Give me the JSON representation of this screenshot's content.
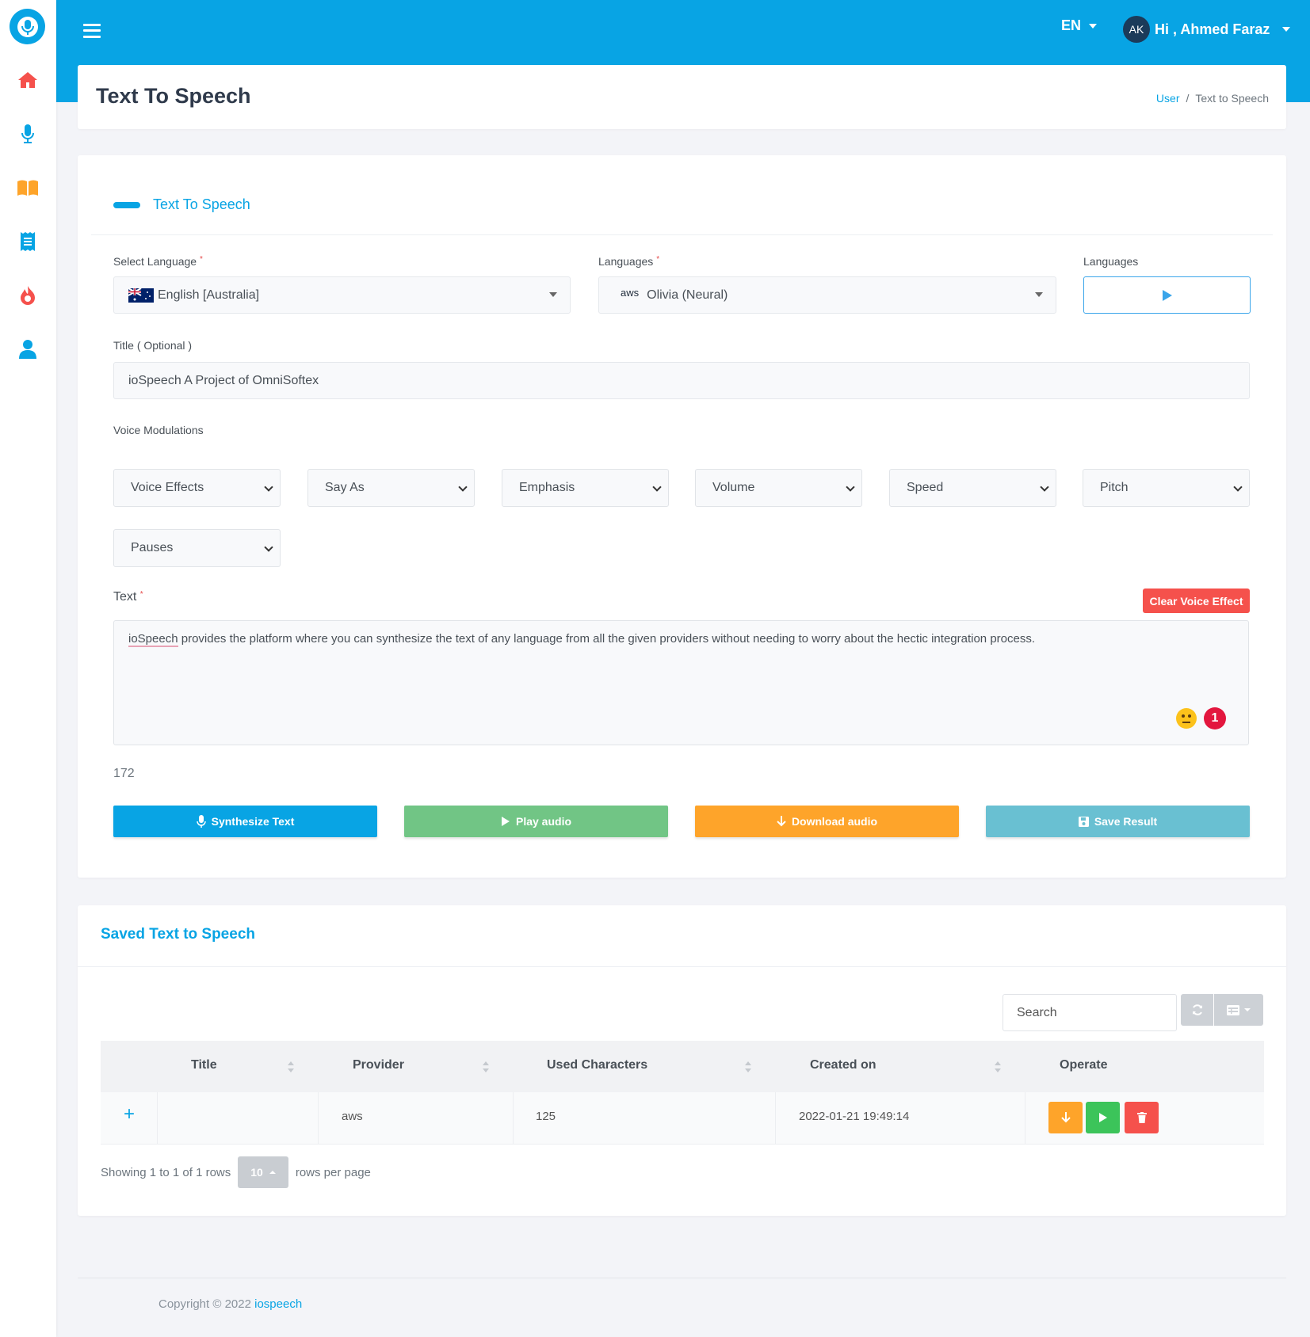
{
  "header": {
    "language": "EN",
    "user_initials": "AK",
    "user_greeting": "Hi , Ahmed Faraz"
  },
  "sidebar": {
    "items": [
      "home-icon",
      "microphone-icon",
      "book-icon",
      "receipt-icon",
      "fire-icon",
      "user-icon"
    ]
  },
  "page": {
    "title": "Text To Speech",
    "breadcrumb": [
      "User",
      "/",
      "Text to Speech"
    ]
  },
  "form": {
    "section_title": "Text To Speech",
    "select_language_label": "Select Language",
    "select_language_value": "English [Australia]",
    "voices_label": "Languages",
    "voice_provider_tag": "aws",
    "voice_value": "Olivia (Neural)",
    "preview_label": "Languages",
    "title_label": "Title ( Optional )",
    "title_value": "ioSpeech A Project of OmniSoftex",
    "modulations_label": "Voice Modulations",
    "modulations": [
      "Voice Effects",
      "Say As",
      "Emphasis",
      "Volume",
      "Speed",
      "Pitch",
      "Pauses"
    ],
    "text_label": "Text",
    "required_mark": "*",
    "clear_button": "Clear Voice Effect",
    "text_first_word": "ioSpeech",
    "text_rest": " provides the platform where you can synthesize the text of any language from all the given providers without needing to worry about the hectic integration process.",
    "grammar_badge": "1",
    "char_count": "172",
    "buttons": {
      "synthesize": "Synthesize Text",
      "play": "Play audio",
      "download": "Download audio",
      "save": "Save Result"
    }
  },
  "saved": {
    "title": "Saved Text to Speech",
    "search_placeholder": "Search",
    "columns": [
      "Title",
      "Provider",
      "Used Characters",
      "Created on",
      "Operate"
    ],
    "rows": [
      {
        "expand": "+",
        "title": "",
        "provider": "aws",
        "used_characters": "125",
        "created_on": "2022-01-21 19:49:14"
      }
    ],
    "pagination": {
      "showing": "Showing 1 to 1 of 1 rows",
      "page_size": "10",
      "rows_per_page": "rows per page"
    }
  },
  "footer": {
    "copyright": "Copyright © 2022",
    "brand": "iospeech"
  },
  "colors": {
    "primary": "#08a4e4",
    "green": "#71c585",
    "orange": "#fea42a",
    "teal": "#69c0d2",
    "red": "#f5514c"
  }
}
